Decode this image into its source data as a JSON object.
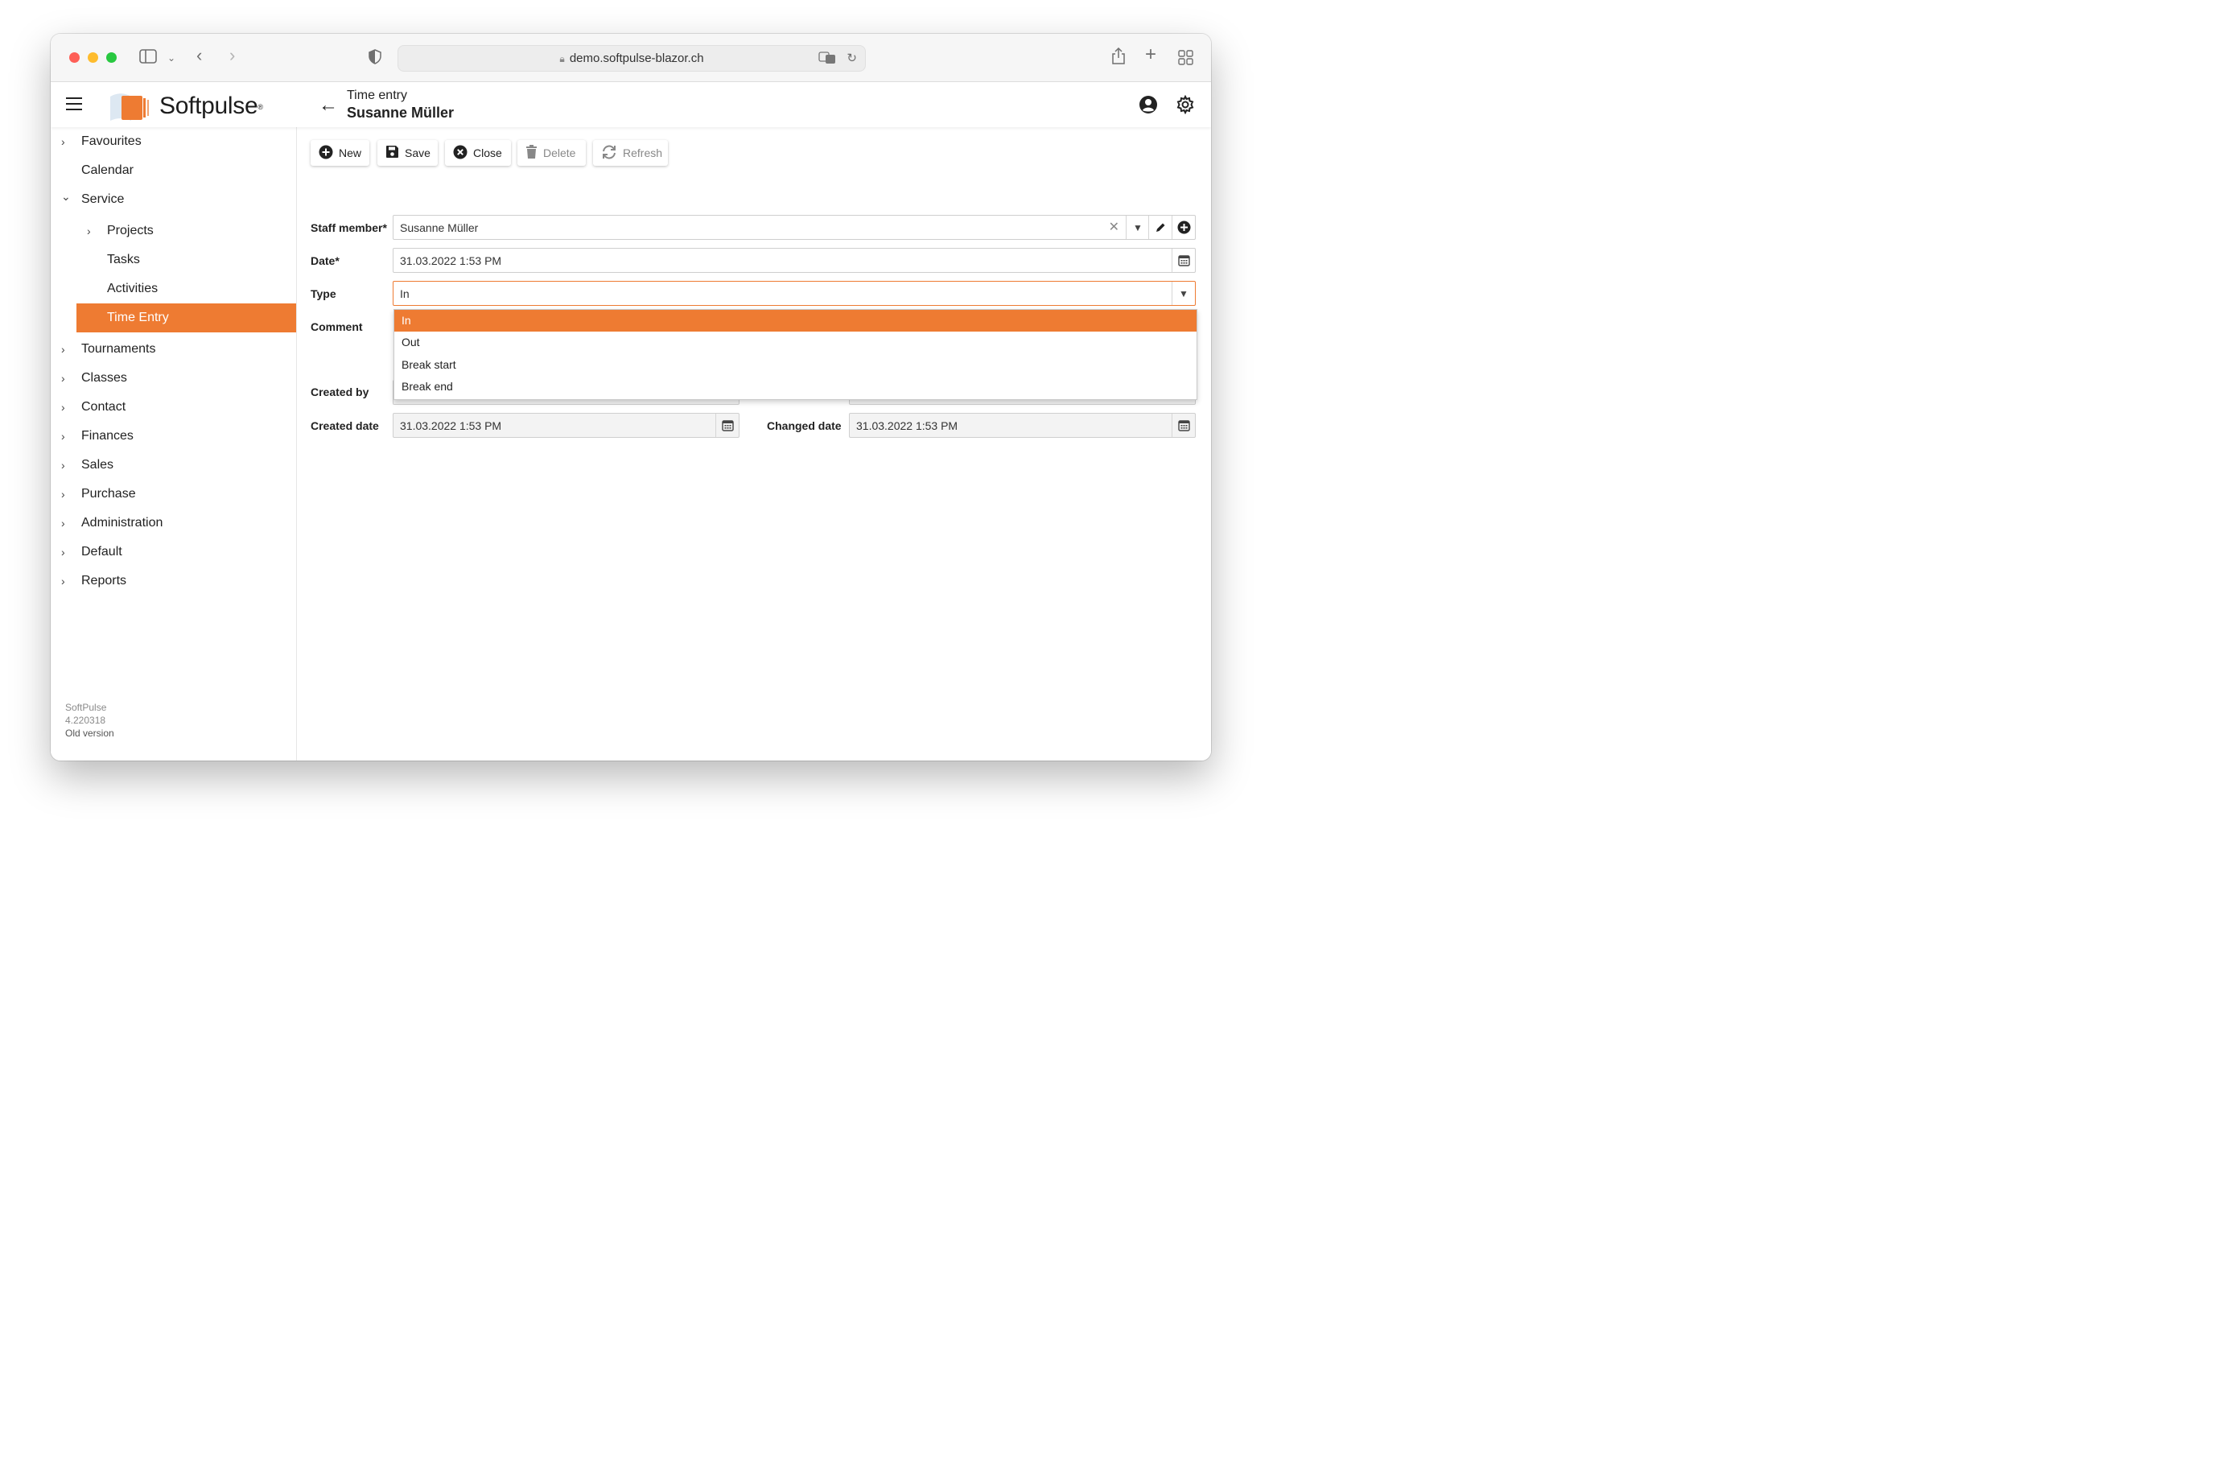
{
  "browser": {
    "url": "demo.softpulse-blazor.ch"
  },
  "app": {
    "logo": "Softpulse",
    "logo_mark": "®",
    "header_subtitle": "Time entry",
    "header_title": "Susanne Müller"
  },
  "sidebar": {
    "items": [
      {
        "label": "Favourites",
        "chevron": "›"
      },
      {
        "label": "Calendar",
        "chevron": ""
      },
      {
        "label": "Service",
        "chevron": "⌄"
      },
      {
        "label": "Projects",
        "chevron": "›"
      },
      {
        "label": "Tasks",
        "chevron": ""
      },
      {
        "label": "Activities",
        "chevron": ""
      },
      {
        "label": "Time Entry",
        "chevron": ""
      },
      {
        "label": "Tournaments",
        "chevron": "›"
      },
      {
        "label": "Classes",
        "chevron": "›"
      },
      {
        "label": "Contact",
        "chevron": "›"
      },
      {
        "label": "Finances",
        "chevron": "›"
      },
      {
        "label": "Sales",
        "chevron": "›"
      },
      {
        "label": "Purchase",
        "chevron": "›"
      },
      {
        "label": "Administration",
        "chevron": "›"
      },
      {
        "label": "Default",
        "chevron": "›"
      },
      {
        "label": "Reports",
        "chevron": "›"
      }
    ],
    "footer_name": "SoftPulse",
    "footer_version": "4.220318",
    "footer_link": "Old version"
  },
  "toolbar": {
    "new_label": "New",
    "save_label": "Save",
    "close_label": "Close",
    "delete_label": "Delete",
    "refresh_label": "Refresh"
  },
  "form": {
    "staff_label": "Staff member*",
    "staff_value": "Susanne Müller",
    "date_label": "Date*",
    "date_value": "31.03.2022 1:53 PM",
    "type_label": "Type",
    "type_value": "In",
    "comment_label": "Comment",
    "created_by_label": "Created by",
    "created_date_label": "Created date",
    "created_date_value": "31.03.2022 1:53 PM",
    "changed_date_label": "Changed date",
    "changed_date_value": "31.03.2022 1:53 PM"
  },
  "type_dropdown": {
    "options": [
      "In",
      "Out",
      "Break start",
      "Break end"
    ]
  },
  "colors": {
    "accent": "#ee7b32"
  }
}
